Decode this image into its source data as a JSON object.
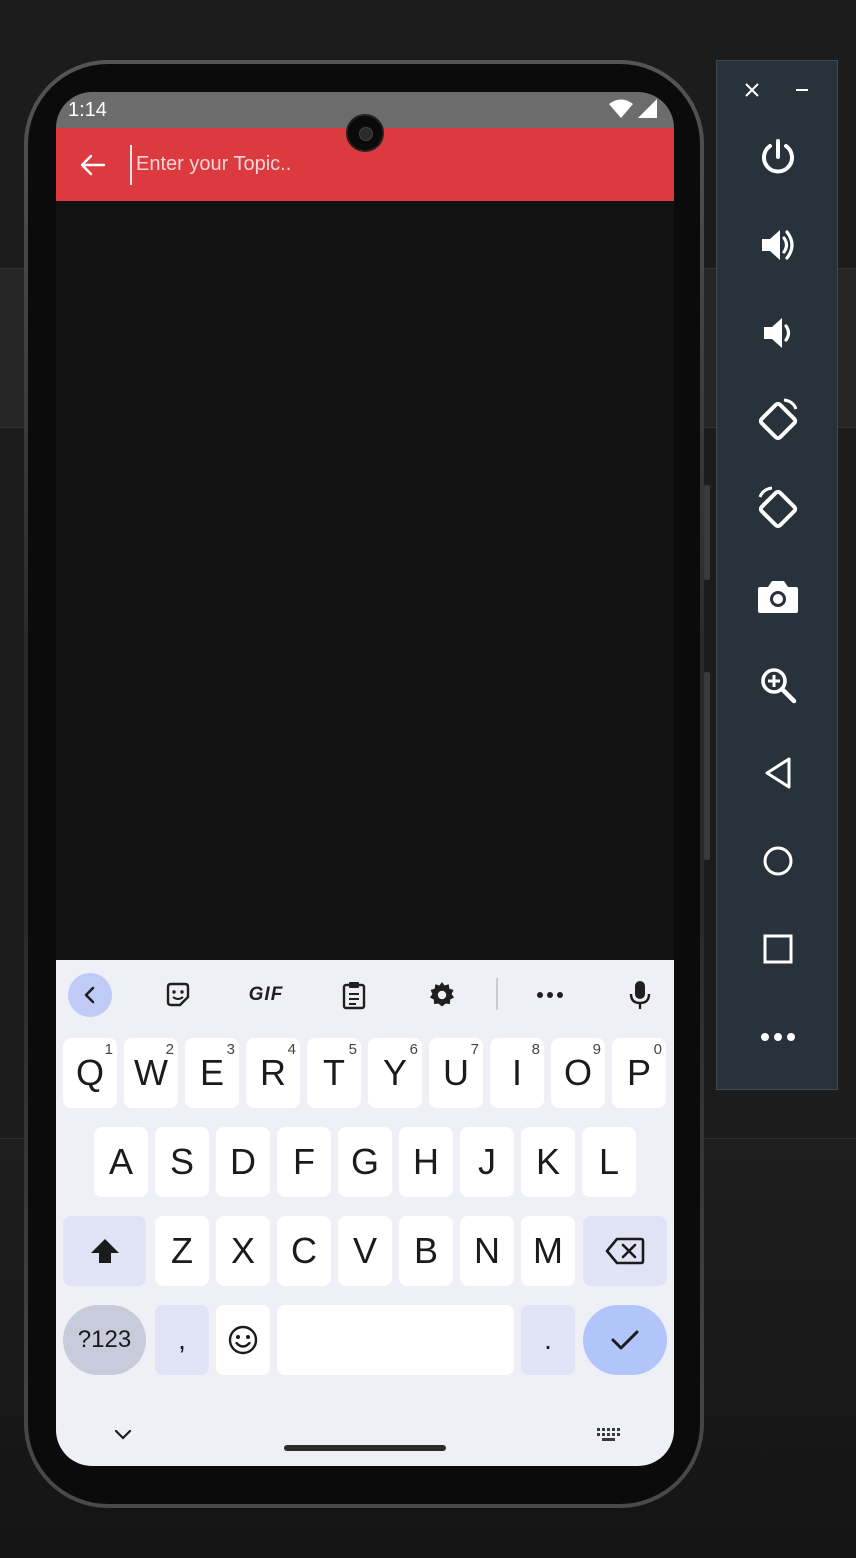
{
  "status_bar": {
    "time": "1:14"
  },
  "app_bar": {
    "search_placeholder": "Enter your Topic.."
  },
  "keyboard": {
    "toolbar": {
      "gif_label": "GIF"
    },
    "row1": [
      {
        "label": "Q",
        "hint": "1"
      },
      {
        "label": "W",
        "hint": "2"
      },
      {
        "label": "E",
        "hint": "3"
      },
      {
        "label": "R",
        "hint": "4"
      },
      {
        "label": "T",
        "hint": "5"
      },
      {
        "label": "Y",
        "hint": "6"
      },
      {
        "label": "U",
        "hint": "7"
      },
      {
        "label": "I",
        "hint": "8"
      },
      {
        "label": "O",
        "hint": "9"
      },
      {
        "label": "P",
        "hint": "0"
      }
    ],
    "row2": [
      "A",
      "S",
      "D",
      "F",
      "G",
      "H",
      "J",
      "K",
      "L"
    ],
    "row3": [
      "Z",
      "X",
      "C",
      "V",
      "B",
      "N",
      "M"
    ],
    "row4": {
      "symbols": "?123",
      "comma": ",",
      "period": "."
    }
  },
  "colors": {
    "app_bar": "#dc3a3f",
    "keyboard_bg": "#eff0f6",
    "enter_key": "#b1c5fa",
    "emulator_toolbar": "#28323a"
  },
  "emulator_toolbar": {
    "buttons": [
      "power-icon",
      "volume-up-icon",
      "volume-down-icon",
      "rotate-left-icon",
      "rotate-right-icon",
      "camera-icon",
      "zoom-icon",
      "back-icon",
      "home-icon",
      "overview-icon",
      "more-icon"
    ]
  }
}
